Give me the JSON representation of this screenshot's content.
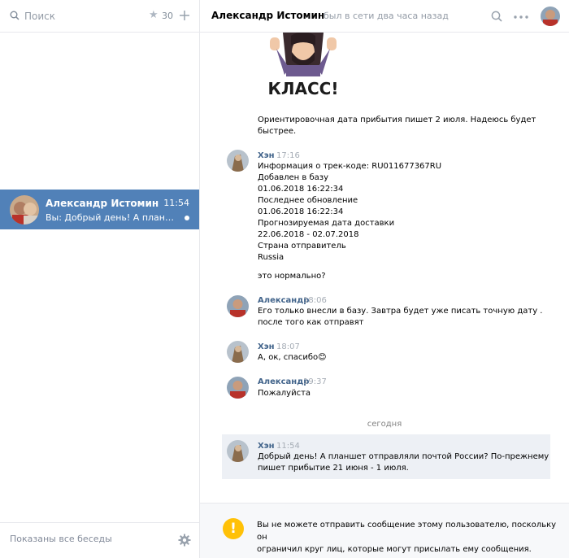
{
  "colors": {
    "accent": "#5181b8",
    "author": "#42648b",
    "unread_bg": "#edf0f5",
    "warning": "#ffc107"
  },
  "sidebar": {
    "search_placeholder": "Поиск",
    "favorites_count": "30",
    "active_dialog": {
      "name": "Александр Истомин",
      "time": "11:54",
      "preview": "Вы: Добрый день! А планшет отпр..."
    },
    "footer_label": "Показаны все беседы"
  },
  "chat": {
    "title": "Александр Истомин",
    "status": "был в сети два часа назад",
    "sticker_text": "КЛАСС!",
    "msg0": {
      "lines": [
        "Ориентировочная дата прибытия пишет 2 июля. Надеюсь будет",
        "быстрее."
      ]
    },
    "msg1": {
      "author": "Хэн",
      "time": "17:16",
      "lines": [
        "Информация о трек-коде: RU011677367RU",
        "Добавлен в базу",
        "01.06.2018 16:22:34",
        "Последнее обновление",
        "01.06.2018 16:22:34",
        "Прогнозируемая дата доставки",
        "22.06.2018 - 02.07.2018",
        "Страна отправитель",
        "Russia"
      ],
      "extra": "это нормально?"
    },
    "msg2": {
      "author": "Александр",
      "time": "18:06",
      "lines": [
        "Его только внесли в базу. Завтра будет уже писать точную дату .",
        "после того как отправят"
      ]
    },
    "msg3": {
      "author": "Хэн",
      "time": "18:07",
      "text": "А, ок, спасибо",
      "emoji": "😊"
    },
    "msg4": {
      "author": "Александр",
      "time": "19:37",
      "text": "Пожалуйста"
    },
    "divider": "сегодня",
    "msg5": {
      "author": "Хэн",
      "time": "11:54",
      "lines": [
        "Добрый день! А планшет отправляли почтой России? По-прежнему",
        "пишет прибытие 21 июня - 1 июля."
      ]
    },
    "footer_warning": [
      "Вы не можете отправить сообщение этому пользователю, поскольку он",
      "ограничил круг лиц, которые могут присылать ему сообщения."
    ],
    "footer_icon": "!"
  }
}
